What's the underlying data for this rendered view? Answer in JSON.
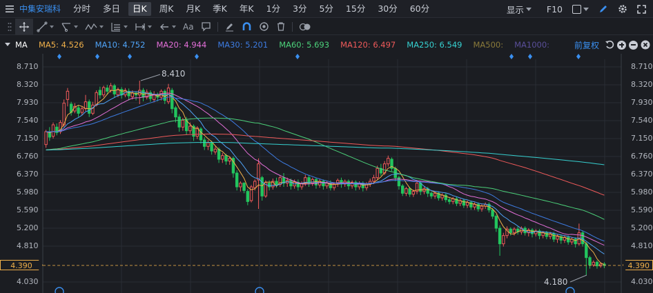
{
  "header": {
    "stock_name": "中集安瑞科",
    "periods": [
      "分时",
      "多日",
      "日K",
      "周K",
      "月K",
      "季K",
      "年K",
      "1分",
      "3分",
      "5分",
      "15分",
      "30分",
      "60分"
    ],
    "active_period": "日K",
    "display_label": "显示",
    "f10_label": "F10"
  },
  "toolbar": {
    "text_tool_label": "Aa"
  },
  "ma_legend": {
    "label": "MA",
    "items": [
      {
        "text": "MA5: 4.526",
        "color": "#f0b04a"
      },
      {
        "text": "MA10: 4.752",
        "color": "#4fa3f7"
      },
      {
        "text": "MA20: 4.944",
        "color": "#e36fd8"
      },
      {
        "text": "MA30: 5.201",
        "color": "#3d7be0"
      },
      {
        "text": "MA60: 5.693",
        "color": "#4cd17a"
      },
      {
        "text": "MA120: 6.497",
        "color": "#ef5a5a"
      },
      {
        "text": "MA250: 6.549",
        "color": "#36d1d1"
      },
      {
        "text": "MA500:",
        "color": "#8a7a3a"
      },
      {
        "text": "MA1000:",
        "color": "#5a4f9a"
      }
    ],
    "adjust_label": "前复权"
  },
  "chart": {
    "y_ticks": [
      "8.710",
      "8.320",
      "7.930",
      "7.540",
      "7.150",
      "6.760",
      "6.370",
      "5.980",
      "5.590",
      "5.200",
      "4.810",
      "4.030"
    ],
    "current_price": "4.390",
    "high_label": "8.410",
    "low_label": "4.180"
  },
  "colors": {
    "up": "#ef5a5a",
    "down": "#22c55e",
    "grid": "#2a2d34",
    "accent": "#3a8ff0"
  },
  "chart_data": {
    "type": "candlestick",
    "ylim": [
      4.03,
      8.71
    ],
    "candles": [
      [
        7.02,
        7.3,
        6.95,
        7.34
      ],
      [
        7.3,
        7.18,
        7.1,
        7.4
      ],
      [
        7.2,
        7.45,
        7.15,
        7.5
      ],
      [
        7.4,
        7.28,
        7.22,
        7.48
      ],
      [
        7.3,
        7.5,
        7.25,
        7.55
      ],
      [
        7.45,
        7.92,
        7.4,
        8.0
      ],
      [
        8.0,
        8.18,
        7.85,
        8.25
      ],
      [
        7.9,
        7.72,
        7.65,
        7.95
      ],
      [
        7.75,
        7.85,
        7.7,
        7.92
      ],
      [
        7.82,
        7.7,
        7.62,
        7.88
      ],
      [
        7.72,
        7.8,
        7.66,
        7.86
      ],
      [
        7.8,
        7.95,
        7.75,
        8.1
      ],
      [
        7.95,
        7.7,
        7.62,
        8.0
      ],
      [
        7.7,
        7.88,
        7.66,
        7.95
      ],
      [
        7.88,
        8.15,
        7.85,
        8.2
      ],
      [
        8.2,
        8.1,
        8.02,
        8.28
      ],
      [
        8.1,
        8.26,
        8.05,
        8.3
      ],
      [
        8.25,
        8.18,
        8.1,
        8.32
      ],
      [
        8.2,
        8.3,
        8.15,
        8.36
      ],
      [
        8.3,
        8.12,
        8.05,
        8.34
      ],
      [
        8.1,
        8.22,
        8.05,
        8.26
      ],
      [
        8.22,
        8.1,
        8.02,
        8.27
      ],
      [
        8.1,
        8.2,
        8.05,
        8.25
      ],
      [
        8.18,
        8.08,
        7.98,
        8.24
      ],
      [
        8.06,
        8.14,
        8.0,
        8.2
      ],
      [
        8.14,
        8.1,
        7.98,
        8.18
      ],
      [
        8.1,
        8.2,
        7.9,
        8.41
      ],
      [
        8.2,
        8.05,
        7.96,
        8.25
      ],
      [
        8.05,
        8.16,
        8.0,
        8.22
      ],
      [
        8.15,
        8.02,
        7.95,
        8.2
      ],
      [
        8.0,
        8.1,
        7.94,
        8.18
      ],
      [
        8.1,
        8.05,
        7.96,
        8.15
      ],
      [
        8.05,
        8.18,
        7.98,
        8.22
      ],
      [
        8.18,
        7.98,
        7.9,
        8.22
      ],
      [
        7.95,
        8.25,
        7.9,
        8.34
      ],
      [
        8.2,
        7.8,
        7.7,
        8.25
      ],
      [
        7.82,
        7.62,
        7.5,
        7.86
      ],
      [
        7.62,
        7.4,
        7.3,
        7.68
      ],
      [
        7.4,
        7.55,
        7.32,
        7.6
      ],
      [
        7.55,
        7.32,
        7.24,
        7.62
      ],
      [
        7.32,
        7.42,
        7.26,
        7.5
      ],
      [
        7.42,
        7.2,
        7.1,
        7.46
      ],
      [
        7.2,
        7.38,
        7.14,
        7.42
      ],
      [
        7.36,
        7.12,
        7.04,
        7.4
      ],
      [
        7.12,
        6.98,
        6.9,
        7.18
      ],
      [
        6.98,
        7.06,
        6.9,
        7.12
      ],
      [
        7.06,
        6.88,
        6.8,
        7.1
      ],
      [
        6.86,
        6.92,
        6.8,
        6.98
      ],
      [
        6.92,
        6.7,
        6.62,
        6.96
      ],
      [
        6.7,
        6.78,
        6.62,
        6.84
      ],
      [
        6.78,
        6.66,
        6.58,
        6.82
      ],
      [
        6.66,
        6.72,
        6.58,
        6.76
      ],
      [
        6.72,
        6.4,
        6.3,
        6.76
      ],
      [
        6.4,
        6.1,
        6.02,
        6.46
      ],
      [
        6.1,
        6.18,
        6.0,
        6.22
      ],
      [
        6.18,
        6.02,
        5.96,
        6.2
      ],
      [
        6.0,
        5.78,
        5.7,
        6.05
      ],
      [
        5.8,
        6.1,
        5.76,
        6.14
      ],
      [
        6.08,
        6.22,
        6.02,
        6.26
      ],
      [
        6.25,
        6.6,
        5.62,
        6.72
      ],
      [
        6.3,
        5.9,
        5.8,
        6.34
      ],
      [
        5.9,
        6.2,
        5.86,
        6.24
      ],
      [
        6.18,
        6.1,
        6.02,
        6.24
      ],
      [
        6.1,
        6.22,
        6.04,
        6.28
      ],
      [
        6.22,
        6.15,
        6.08,
        6.3
      ],
      [
        6.15,
        6.3,
        6.1,
        6.34
      ],
      [
        6.3,
        6.18,
        6.1,
        6.4
      ],
      [
        6.18,
        6.24,
        6.1,
        6.3
      ],
      [
        6.24,
        6.12,
        6.04,
        6.28
      ],
      [
        6.12,
        6.2,
        6.06,
        6.26
      ],
      [
        6.2,
        6.1,
        6.02,
        6.26
      ],
      [
        6.1,
        6.18,
        6.04,
        6.22
      ],
      [
        6.18,
        6.3,
        6.12,
        6.36
      ],
      [
        6.3,
        6.18,
        6.1,
        6.34
      ],
      [
        6.18,
        6.26,
        6.12,
        6.3
      ],
      [
        6.26,
        6.14,
        6.06,
        6.3
      ],
      [
        6.14,
        6.22,
        6.08,
        6.28
      ],
      [
        6.22,
        6.12,
        6.04,
        6.26
      ],
      [
        6.12,
        6.18,
        6.06,
        6.22
      ],
      [
        6.18,
        6.08,
        6.02,
        6.24
      ],
      [
        6.08,
        6.16,
        6.02,
        6.2
      ],
      [
        6.16,
        6.24,
        6.1,
        6.28
      ],
      [
        6.24,
        6.16,
        6.08,
        6.3
      ],
      [
        6.16,
        6.22,
        6.1,
        6.26
      ],
      [
        6.22,
        6.12,
        6.04,
        6.26
      ],
      [
        6.12,
        6.2,
        6.06,
        6.24
      ],
      [
        6.2,
        6.1,
        6.02,
        6.24
      ],
      [
        6.1,
        6.18,
        6.04,
        6.22
      ],
      [
        6.18,
        6.08,
        6.0,
        6.22
      ],
      [
        6.08,
        6.16,
        6.02,
        6.2
      ],
      [
        6.16,
        6.22,
        6.1,
        6.28
      ],
      [
        6.22,
        6.3,
        6.16,
        6.36
      ],
      [
        6.3,
        6.5,
        6.26,
        6.56
      ],
      [
        6.5,
        6.4,
        6.34,
        6.6
      ],
      [
        6.4,
        6.6,
        6.36,
        6.66
      ],
      [
        6.6,
        6.72,
        6.54,
        6.78
      ],
      [
        6.7,
        6.5,
        6.44,
        6.74
      ],
      [
        6.5,
        6.3,
        6.22,
        6.54
      ],
      [
        6.3,
        6.12,
        6.04,
        6.34
      ],
      [
        6.12,
        5.96,
        5.9,
        6.16
      ],
      [
        5.96,
        6.06,
        5.9,
        6.1
      ],
      [
        6.06,
        5.94,
        5.88,
        6.1
      ],
      [
        5.94,
        6.0,
        5.88,
        6.04
      ],
      [
        6.0,
        6.18,
        5.94,
        6.24
      ],
      [
        6.18,
        6.0,
        5.92,
        6.22
      ],
      [
        6.0,
        6.06,
        5.94,
        6.1
      ],
      [
        6.06,
        5.96,
        5.88,
        6.1
      ],
      [
        5.96,
        5.9,
        5.84,
        6.0
      ],
      [
        5.9,
        5.96,
        5.84,
        6.0
      ],
      [
        5.96,
        5.86,
        5.8,
        6.0
      ],
      [
        5.86,
        5.92,
        5.8,
        5.96
      ],
      [
        5.92,
        5.82,
        5.76,
        5.96
      ],
      [
        5.82,
        5.78,
        5.72,
        5.86
      ],
      [
        5.78,
        5.84,
        5.72,
        5.88
      ],
      [
        5.84,
        5.74,
        5.68,
        5.88
      ],
      [
        5.74,
        5.8,
        5.68,
        5.84
      ],
      [
        5.8,
        5.7,
        5.64,
        5.84
      ],
      [
        5.7,
        5.76,
        5.64,
        5.8
      ],
      [
        5.76,
        5.66,
        5.6,
        5.8
      ],
      [
        5.66,
        5.72,
        5.6,
        5.76
      ],
      [
        5.72,
        5.62,
        5.56,
        5.76
      ],
      [
        5.62,
        5.68,
        5.56,
        5.72
      ],
      [
        5.68,
        5.72,
        5.62,
        5.76
      ],
      [
        5.72,
        5.6,
        5.54,
        5.76
      ],
      [
        5.6,
        5.46,
        5.4,
        5.64
      ],
      [
        5.46,
        5.2,
        5.12,
        5.5
      ],
      [
        5.2,
        4.86,
        4.6,
        5.26
      ],
      [
        4.86,
        5.04,
        4.8,
        5.1
      ],
      [
        5.04,
        5.18,
        4.98,
        5.24
      ],
      [
        5.18,
        5.1,
        5.04,
        5.22
      ],
      [
        5.1,
        5.18,
        5.04,
        5.22
      ],
      [
        5.18,
        5.12,
        5.06,
        5.24
      ],
      [
        5.12,
        5.2,
        5.06,
        5.24
      ],
      [
        5.2,
        5.1,
        5.04,
        5.24
      ],
      [
        5.1,
        5.16,
        5.02,
        5.2
      ],
      [
        5.16,
        5.08,
        5.0,
        5.2
      ],
      [
        5.08,
        5.14,
        5.02,
        5.18
      ],
      [
        5.14,
        5.04,
        4.96,
        5.18
      ],
      [
        5.04,
        5.1,
        4.98,
        5.14
      ],
      [
        5.1,
        5.02,
        4.96,
        5.14
      ],
      [
        5.02,
        5.08,
        4.96,
        5.12
      ],
      [
        5.08,
        4.96,
        4.9,
        5.12
      ],
      [
        4.96,
        5.02,
        4.88,
        5.06
      ],
      [
        5.02,
        4.94,
        4.86,
        5.06
      ],
      [
        4.94,
        5.0,
        4.88,
        5.04
      ],
      [
        5.0,
        4.9,
        4.84,
        5.04
      ],
      [
        4.9,
        4.96,
        4.84,
        5.0
      ],
      [
        4.96,
        4.86,
        4.78,
        5.0
      ],
      [
        4.86,
        5.1,
        4.82,
        5.3
      ],
      [
        5.1,
        4.86,
        4.8,
        5.14
      ],
      [
        4.86,
        4.56,
        4.18,
        4.9
      ],
      [
        4.56,
        4.4,
        4.32,
        4.6
      ],
      [
        4.4,
        4.46,
        4.36,
        4.5
      ],
      [
        4.46,
        4.38,
        4.32,
        4.5
      ],
      [
        4.38,
        4.42,
        4.34,
        4.46
      ],
      [
        4.42,
        4.39,
        4.33,
        4.46
      ]
    ],
    "ma_lines": [
      {
        "name": "MA5",
        "color": "#f0b04a"
      },
      {
        "name": "MA10",
        "color": "#4fa3f7"
      },
      {
        "name": "MA20",
        "color": "#e36fd8"
      },
      {
        "name": "MA30",
        "color": "#3d7be0"
      },
      {
        "name": "MA60",
        "color": "#4cd17a"
      },
      {
        "name": "MA120",
        "color": "#ef5a5a"
      },
      {
        "name": "MA250",
        "color": "#36d1d1"
      }
    ]
  }
}
